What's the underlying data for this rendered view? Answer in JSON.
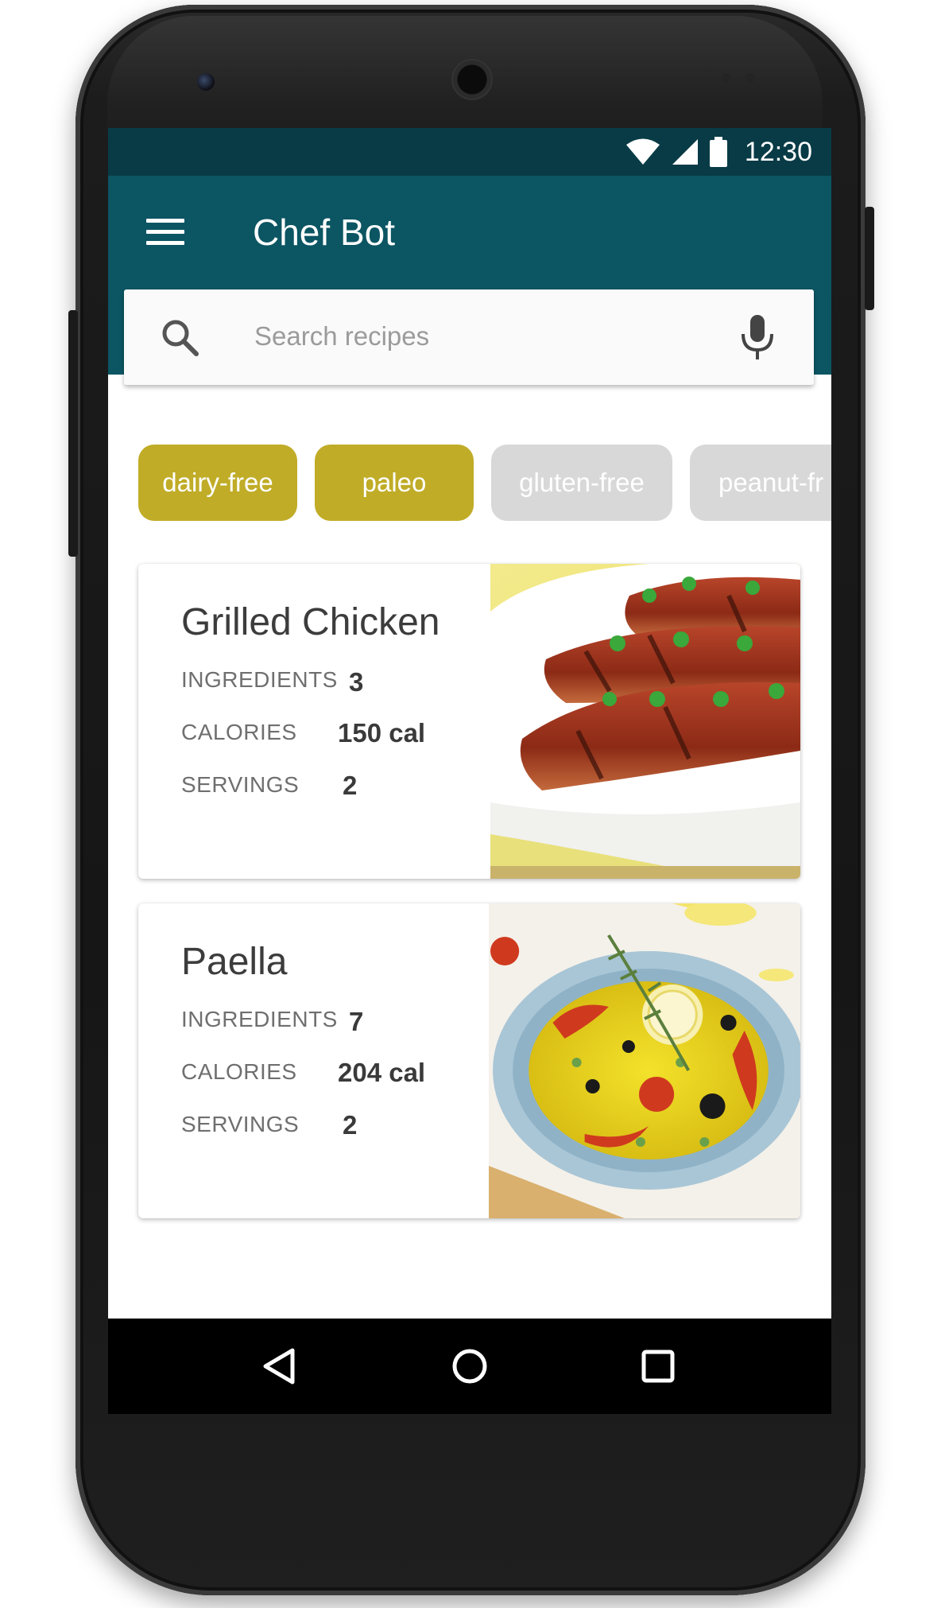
{
  "status_bar": {
    "time": "12:30",
    "icons": [
      "wifi-icon",
      "cellular-signal-icon",
      "battery-icon"
    ]
  },
  "app_bar": {
    "title": "Chef Bot",
    "menu_icon": "menu-icon"
  },
  "search": {
    "placeholder": "Search recipes",
    "value": "",
    "icon": "search-icon",
    "voice_icon": "mic-icon"
  },
  "filters": [
    {
      "label": "dairy-free",
      "selected": true
    },
    {
      "label": "paleo",
      "selected": true
    },
    {
      "label": "gluten-free",
      "selected": false
    },
    {
      "label": "peanut-fr",
      "selected": false
    }
  ],
  "recipes": [
    {
      "name": "Grilled Chicken",
      "ingredients_label": "INGREDIENTS",
      "ingredients": "3",
      "calories_label": "CALORIES",
      "calories": "150 cal",
      "servings_label": "SERVINGS",
      "servings": "2"
    },
    {
      "name": "Paella",
      "ingredients_label": "INGREDIENTS",
      "ingredients": "7",
      "calories_label": "CALORIES",
      "calories": "204 cal",
      "servings_label": "SERVINGS",
      "servings": "2"
    }
  ],
  "nav_bar": {
    "buttons": [
      "back-icon",
      "home-icon",
      "recents-icon"
    ]
  },
  "colors": {
    "status_bar": "#083b46",
    "app_bar": "#0c5563",
    "chip_active": "#c0ac27",
    "chip_inactive": "#d8d8d8"
  }
}
